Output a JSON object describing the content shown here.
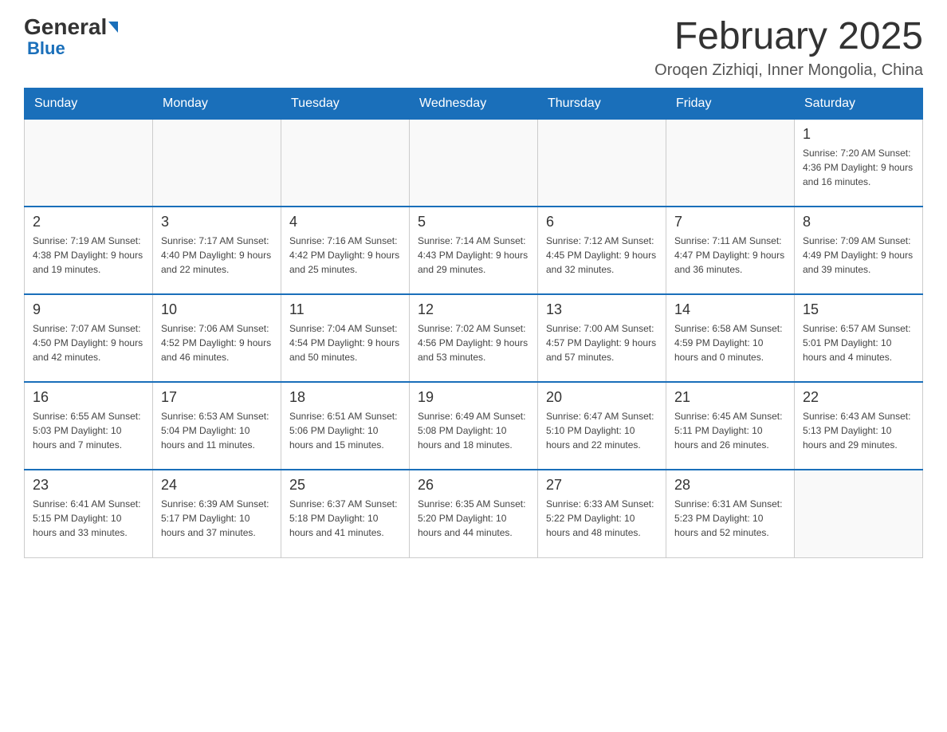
{
  "logo": {
    "general": "General",
    "blue": "Blue"
  },
  "title": "February 2025",
  "location": "Oroqen Zizhiqi, Inner Mongolia, China",
  "days_of_week": [
    "Sunday",
    "Monday",
    "Tuesday",
    "Wednesday",
    "Thursday",
    "Friday",
    "Saturday"
  ],
  "weeks": [
    [
      {
        "day": "",
        "info": ""
      },
      {
        "day": "",
        "info": ""
      },
      {
        "day": "",
        "info": ""
      },
      {
        "day": "",
        "info": ""
      },
      {
        "day": "",
        "info": ""
      },
      {
        "day": "",
        "info": ""
      },
      {
        "day": "1",
        "info": "Sunrise: 7:20 AM\nSunset: 4:36 PM\nDaylight: 9 hours\nand 16 minutes."
      }
    ],
    [
      {
        "day": "2",
        "info": "Sunrise: 7:19 AM\nSunset: 4:38 PM\nDaylight: 9 hours\nand 19 minutes."
      },
      {
        "day": "3",
        "info": "Sunrise: 7:17 AM\nSunset: 4:40 PM\nDaylight: 9 hours\nand 22 minutes."
      },
      {
        "day": "4",
        "info": "Sunrise: 7:16 AM\nSunset: 4:42 PM\nDaylight: 9 hours\nand 25 minutes."
      },
      {
        "day": "5",
        "info": "Sunrise: 7:14 AM\nSunset: 4:43 PM\nDaylight: 9 hours\nand 29 minutes."
      },
      {
        "day": "6",
        "info": "Sunrise: 7:12 AM\nSunset: 4:45 PM\nDaylight: 9 hours\nand 32 minutes."
      },
      {
        "day": "7",
        "info": "Sunrise: 7:11 AM\nSunset: 4:47 PM\nDaylight: 9 hours\nand 36 minutes."
      },
      {
        "day": "8",
        "info": "Sunrise: 7:09 AM\nSunset: 4:49 PM\nDaylight: 9 hours\nand 39 minutes."
      }
    ],
    [
      {
        "day": "9",
        "info": "Sunrise: 7:07 AM\nSunset: 4:50 PM\nDaylight: 9 hours\nand 42 minutes."
      },
      {
        "day": "10",
        "info": "Sunrise: 7:06 AM\nSunset: 4:52 PM\nDaylight: 9 hours\nand 46 minutes."
      },
      {
        "day": "11",
        "info": "Sunrise: 7:04 AM\nSunset: 4:54 PM\nDaylight: 9 hours\nand 50 minutes."
      },
      {
        "day": "12",
        "info": "Sunrise: 7:02 AM\nSunset: 4:56 PM\nDaylight: 9 hours\nand 53 minutes."
      },
      {
        "day": "13",
        "info": "Sunrise: 7:00 AM\nSunset: 4:57 PM\nDaylight: 9 hours\nand 57 minutes."
      },
      {
        "day": "14",
        "info": "Sunrise: 6:58 AM\nSunset: 4:59 PM\nDaylight: 10 hours\nand 0 minutes."
      },
      {
        "day": "15",
        "info": "Sunrise: 6:57 AM\nSunset: 5:01 PM\nDaylight: 10 hours\nand 4 minutes."
      }
    ],
    [
      {
        "day": "16",
        "info": "Sunrise: 6:55 AM\nSunset: 5:03 PM\nDaylight: 10 hours\nand 7 minutes."
      },
      {
        "day": "17",
        "info": "Sunrise: 6:53 AM\nSunset: 5:04 PM\nDaylight: 10 hours\nand 11 minutes."
      },
      {
        "day": "18",
        "info": "Sunrise: 6:51 AM\nSunset: 5:06 PM\nDaylight: 10 hours\nand 15 minutes."
      },
      {
        "day": "19",
        "info": "Sunrise: 6:49 AM\nSunset: 5:08 PM\nDaylight: 10 hours\nand 18 minutes."
      },
      {
        "day": "20",
        "info": "Sunrise: 6:47 AM\nSunset: 5:10 PM\nDaylight: 10 hours\nand 22 minutes."
      },
      {
        "day": "21",
        "info": "Sunrise: 6:45 AM\nSunset: 5:11 PM\nDaylight: 10 hours\nand 26 minutes."
      },
      {
        "day": "22",
        "info": "Sunrise: 6:43 AM\nSunset: 5:13 PM\nDaylight: 10 hours\nand 29 minutes."
      }
    ],
    [
      {
        "day": "23",
        "info": "Sunrise: 6:41 AM\nSunset: 5:15 PM\nDaylight: 10 hours\nand 33 minutes."
      },
      {
        "day": "24",
        "info": "Sunrise: 6:39 AM\nSunset: 5:17 PM\nDaylight: 10 hours\nand 37 minutes."
      },
      {
        "day": "25",
        "info": "Sunrise: 6:37 AM\nSunset: 5:18 PM\nDaylight: 10 hours\nand 41 minutes."
      },
      {
        "day": "26",
        "info": "Sunrise: 6:35 AM\nSunset: 5:20 PM\nDaylight: 10 hours\nand 44 minutes."
      },
      {
        "day": "27",
        "info": "Sunrise: 6:33 AM\nSunset: 5:22 PM\nDaylight: 10 hours\nand 48 minutes."
      },
      {
        "day": "28",
        "info": "Sunrise: 6:31 AM\nSunset: 5:23 PM\nDaylight: 10 hours\nand 52 minutes."
      },
      {
        "day": "",
        "info": ""
      }
    ]
  ]
}
